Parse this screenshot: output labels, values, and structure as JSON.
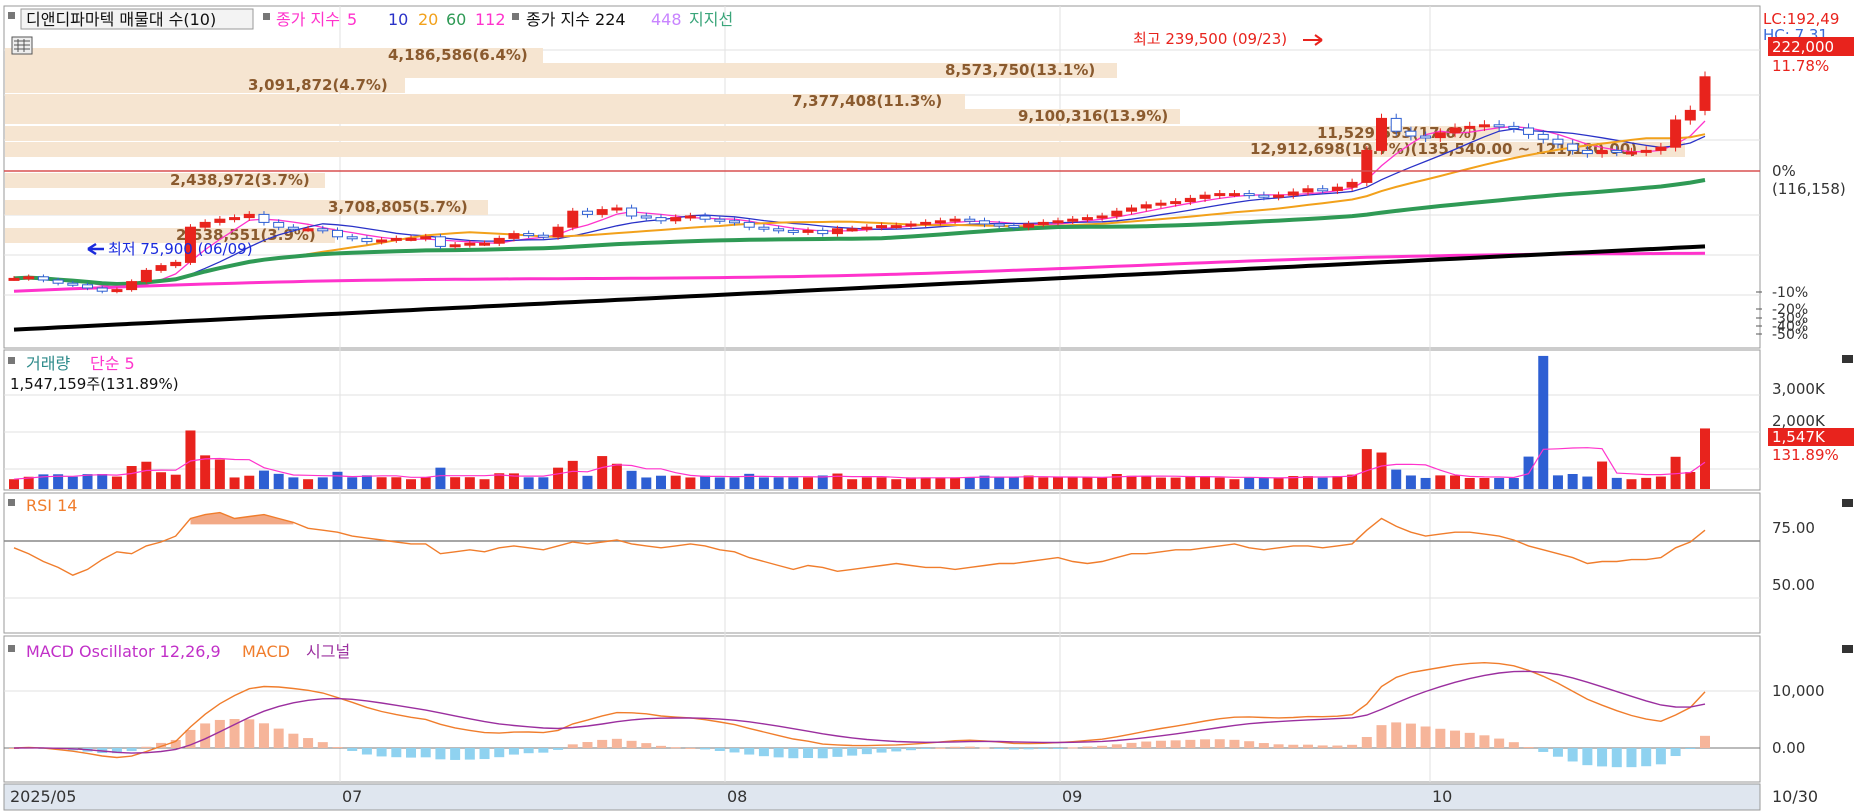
{
  "price_header": {
    "title": "디앤디파마텍 매물대 수(10)",
    "ma_label": "종가 지수",
    "ma_periods": [
      "5",
      "10",
      "20",
      "60",
      "112"
    ],
    "ma2_label": "종가 지수 224",
    "ma2_extra": "448",
    "support_label": "지지선"
  },
  "price_annotations": {
    "high_label": "최고 239,500 (09/23)",
    "low_label": "최저 75,900 (06/09)",
    "lc_label": "LC:192,49",
    "hc_label": "HC: 7.31",
    "current_price": "222,000",
    "current_change": "11.78%",
    "zero_pct_label": "0%",
    "zero_price_label": "(116,158)",
    "neg_ticks": [
      "-10%",
      "-20%",
      "-30%",
      "-40%",
      "-50%"
    ]
  },
  "volume_profile": [
    {
      "label": "4,186,586(6.4%)"
    },
    {
      "label": "8,573,750(13.1%)"
    },
    {
      "label": "3,091,872(4.7%)"
    },
    {
      "label": "7,377,408(11.3%)"
    },
    {
      "label": "9,100,316(13.9%)"
    },
    {
      "label": "11,529,593(17.6%)"
    },
    {
      "label": "12,912,698(19.7%)(135,540.00 ~ 121,130.00)"
    },
    {
      "label": "2,438,972(3.7%)"
    },
    {
      "label": "3,708,805(5.7%)"
    },
    {
      "label": "2,538,551(3.9%)"
    }
  ],
  "volume_header": {
    "title": "거래량",
    "ma_label": "단순 5",
    "current_value": "1,547,159주(131.89%)",
    "tick_3000k": "3,000K",
    "tick_2000k": "2,000K",
    "badge_value": "1,547K",
    "badge_pct": "131.89%"
  },
  "rsi_header": {
    "title": "RSI 14",
    "tick_75": "75.00",
    "tick_50": "50.00"
  },
  "macd_header": {
    "title": "MACD Oscillator 12,26,9",
    "macd_label": "MACD",
    "signal_label": "시그널",
    "tick_10000": "10,000",
    "tick_0": "0.00"
  },
  "date_axis": {
    "labels": [
      "2025/05",
      "07",
      "08",
      "09",
      "10"
    ],
    "end_label": "10/30"
  },
  "colors": {
    "up": "#e8231d",
    "down": "#2e5fd3",
    "ma5": "#ff33cc",
    "ma10": "#2a32c8",
    "ma20": "#f2a11b",
    "ma60": "#2f9a55",
    "ma112": "#ff33cc",
    "ma224": "#000000",
    "ma448": "#c884ff",
    "support": "#3aa57a",
    "rsi": "#f07d2c",
    "macd_line": "#f07d2c",
    "signal_line": "#9b2f9f",
    "osc_pos": "#f6b59a",
    "osc_neg": "#8fd2f0",
    "profile_band": "#f6e5d1"
  },
  "chart_data": [
    {
      "type": "candlestick",
      "title": "디앤디파마텍",
      "y_unit": "KRW",
      "x_start": "2025-05",
      "x_end": "2025-10-30",
      "high": {
        "value": 239500,
        "date": "09/23"
      },
      "low": {
        "value": 75900,
        "date": "06/09"
      },
      "last_close": 222000,
      "closes_approx": [
        96000,
        97000,
        95000,
        93000,
        92000,
        90000,
        88000,
        89000,
        94000,
        101000,
        104000,
        106000,
        128000,
        131000,
        133000,
        134000,
        136000,
        131000,
        128000,
        127000,
        127000,
        126000,
        122000,
        121000,
        119000,
        120000,
        121000,
        121000,
        122000,
        116000,
        117000,
        118000,
        118000,
        121000,
        124000,
        123000,
        122000,
        128000,
        138000,
        136000,
        139000,
        140000,
        135000,
        134000,
        132000,
        134000,
        135000,
        133000,
        132000,
        131000,
        128000,
        127000,
        126000,
        125000,
        126000,
        124000,
        127000,
        127000,
        128000,
        129000,
        129000,
        130000,
        131000,
        132000,
        133000,
        132000,
        130000,
        129000,
        128000,
        130000,
        131000,
        132000,
        133000,
        134000,
        135000,
        138000,
        140000,
        142000,
        143000,
        144000,
        146000,
        148000,
        149000,
        149000,
        148000,
        147000,
        148000,
        150000,
        152000,
        151000,
        153000,
        156000,
        176000,
        196000,
        188000,
        185000,
        184000,
        187000,
        190000,
        191000,
        192000,
        191000,
        190000,
        186000,
        183000,
        180000,
        176000,
        174000,
        176000,
        175000,
        175000,
        176000,
        178000,
        195000,
        201000,
        222000
      ],
      "moving_averages": [
        "5",
        "10",
        "20",
        "60",
        "112",
        "224"
      ],
      "volume_profile_range": "135,540.00 ~ 121,130.00"
    },
    {
      "type": "bar",
      "title": "거래량",
      "y_unit": "shares",
      "last_value": 1547159,
      "last_pct_of_ma": 131.89,
      "ylim": [
        0,
        3500000
      ]
    },
    {
      "type": "line",
      "title": "RSI 14",
      "ylim": [
        0,
        100
      ],
      "reference_lines": [
        75,
        50
      ],
      "values_approx": [
        63,
        60,
        56,
        53,
        49,
        52,
        57,
        61,
        60,
        64,
        66,
        69,
        78,
        80,
        81,
        78,
        79,
        80,
        78,
        76,
        73,
        72,
        71,
        69,
        68,
        67,
        66,
        65,
        65,
        60,
        61,
        62,
        61,
        63,
        64,
        63,
        62,
        64,
        66,
        65,
        66,
        67,
        65,
        64,
        63,
        64,
        65,
        64,
        62,
        61,
        58,
        56,
        54,
        52,
        54,
        53,
        51,
        52,
        53,
        54,
        55,
        54,
        53,
        53,
        52,
        53,
        54,
        55,
        55,
        56,
        57,
        58,
        56,
        55,
        56,
        58,
        60,
        60,
        61,
        62,
        62,
        63,
        64,
        65,
        63,
        62,
        63,
        64,
        64,
        63,
        64,
        65,
        72,
        78,
        74,
        71,
        69,
        70,
        71,
        71,
        70,
        69,
        67,
        64,
        62,
        60,
        58,
        55,
        56,
        56,
        57,
        57,
        58,
        63,
        66,
        72
      ]
    },
    {
      "type": "line",
      "title": "MACD Oscillator 12,26,9",
      "series_labels": [
        "MACD",
        "시그널"
      ],
      "reference_lines": [
        0,
        10000
      ]
    }
  ]
}
